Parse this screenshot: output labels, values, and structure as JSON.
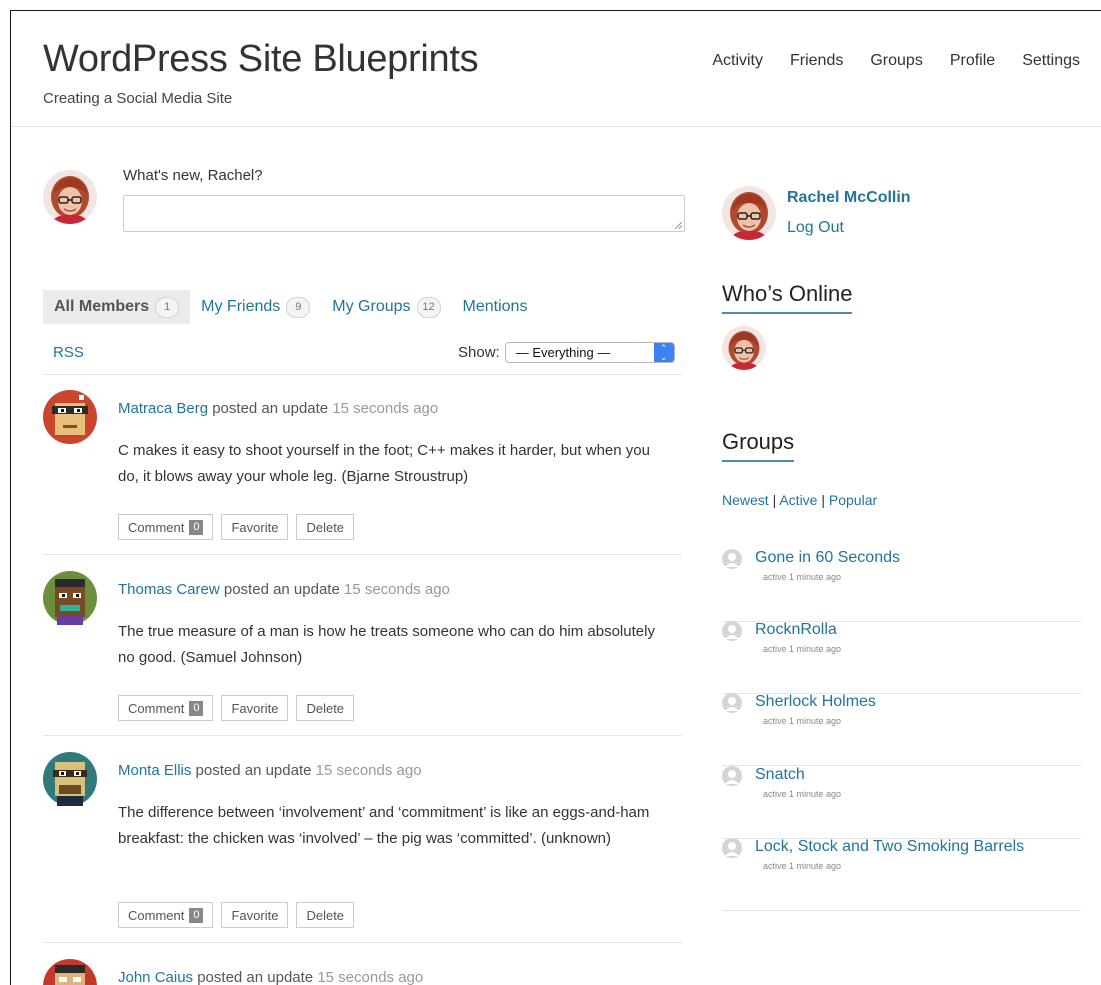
{
  "site": {
    "title": "WordPress Site Blueprints",
    "tagline": "Creating a Social Media Site"
  },
  "nav": [
    "Activity",
    "Friends",
    "Groups",
    "Profile",
    "Settings"
  ],
  "post_form": {
    "label": "What's new, Rachel?",
    "placeholder": ""
  },
  "tabs": [
    {
      "label": "All Members",
      "count": "1",
      "active": true
    },
    {
      "label": "My Friends",
      "count": "9"
    },
    {
      "label": "My Groups",
      "count": "12"
    },
    {
      "label": "Mentions",
      "count": ""
    }
  ],
  "rss": "RSS",
  "filter": {
    "label": "Show:",
    "selected": "— Everything —"
  },
  "activities": [
    {
      "user": "Matraca Berg",
      "action": "posted an update",
      "time": "15 seconds ago",
      "content": "C makes it easy to shoot yourself in the foot; C++ makes it harder, but when you do, it blows away your whole leg. (Bjarne Stroustrup)",
      "buttons": {
        "comment": "Comment",
        "comment_count": "0",
        "favorite": "Favorite",
        "delete": "Delete"
      }
    },
    {
      "user": "Thomas Carew",
      "action": "posted an update",
      "time": "15 seconds ago",
      "content": "The true measure of a man is how he treats someone who can do him absolutely no good. (Samuel Johnson)",
      "buttons": {
        "comment": "Comment",
        "comment_count": "0",
        "favorite": "Favorite",
        "delete": "Delete"
      }
    },
    {
      "user": "Monta Ellis",
      "action": "posted an update",
      "time": "15 seconds ago",
      "content": "The difference between ‘involvement’ and ‘commitment’ is like an eggs-and-ham breakfast: the chicken was ‘involved’ – the pig was ‘committed’. (unknown)",
      "buttons": {
        "comment": "Comment",
        "comment_count": "0",
        "favorite": "Favorite",
        "delete": "Delete"
      }
    },
    {
      "user": "John Caius",
      "action": "posted an update",
      "time": "15 seconds ago"
    }
  ],
  "sidebar": {
    "user_name": "Rachel McCollin",
    "logout": "Log Out",
    "whos_online_title": "Who’s Online",
    "groups_title": "Groups",
    "group_filters": [
      "Newest",
      "Active",
      "Popular"
    ],
    "group_filter_sep": "|",
    "groups": [
      {
        "name": "Gone in 60 Seconds",
        "activity": "active 1 minute ago"
      },
      {
        "name": "RocknRolla",
        "activity": "active 1 minute ago"
      },
      {
        "name": "Sherlock Holmes",
        "activity": "active 1 minute ago"
      },
      {
        "name": "Snatch",
        "activity": "active 1 minute ago"
      },
      {
        "name": "Lock, Stock and Two Smoking Barrels",
        "activity": "active 1 minute ago"
      }
    ]
  },
  "colors": {
    "link": "#21759b",
    "widget_underline": "#4b8eb3",
    "select_accent": "#3b82f6"
  }
}
